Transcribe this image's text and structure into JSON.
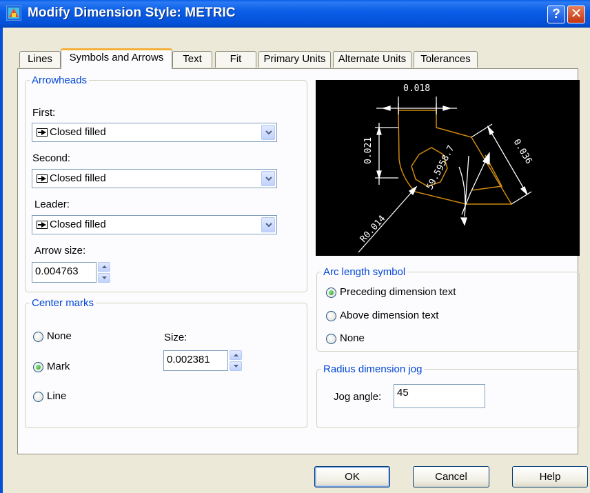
{
  "window": {
    "title": "Modify Dimension Style: METRIC",
    "help_glyph": "?",
    "close_glyph": "✕"
  },
  "tabs": [
    {
      "label": "Lines"
    },
    {
      "label": "Symbols and Arrows",
      "active": true
    },
    {
      "label": "Text"
    },
    {
      "label": "Fit"
    },
    {
      "label": "Primary Units"
    },
    {
      "label": "Alternate Units"
    },
    {
      "label": "Tolerances"
    }
  ],
  "arrowheads": {
    "title": "Arrowheads",
    "first_label": "First:",
    "first_value": "Closed filled",
    "second_label": "Second:",
    "second_value": "Closed filled",
    "leader_label": "Leader:",
    "leader_value": "Closed filled",
    "arrow_size_label": "Arrow size:",
    "arrow_size_value": "0.004763"
  },
  "center_marks": {
    "title": "Center marks",
    "options": [
      {
        "label": "None",
        "selected": false
      },
      {
        "label": "Mark",
        "selected": true
      },
      {
        "label": "Line",
        "selected": false
      }
    ],
    "size_label": "Size:",
    "size_value": "0.002381"
  },
  "preview": {
    "dim_top": "0.018",
    "dim_left": "0.021",
    "dim_right": "0.036",
    "dim_angle": "59.5958.7",
    "dim_radius": "R0.014",
    "colors": {
      "background": "#000000",
      "geometry": "#d08a10",
      "dimension": "#ffffff"
    }
  },
  "arc_length": {
    "title": "Arc length symbol",
    "options": [
      {
        "label": "Preceding dimension text",
        "selected": true
      },
      {
        "label": "Above dimension text",
        "selected": false
      },
      {
        "label": "None",
        "selected": false
      }
    ]
  },
  "radius_jog": {
    "title": "Radius dimension jog",
    "jog_angle_label": "Jog angle:",
    "jog_angle_value": "45"
  },
  "buttons": {
    "ok": "OK",
    "cancel": "Cancel",
    "help": "Help"
  },
  "colors": {
    "titlebar": "#0450d6",
    "group_title": "#0046d5",
    "dialog_bg": "#ece9d8",
    "panel_bg": "#fcfcfe"
  }
}
